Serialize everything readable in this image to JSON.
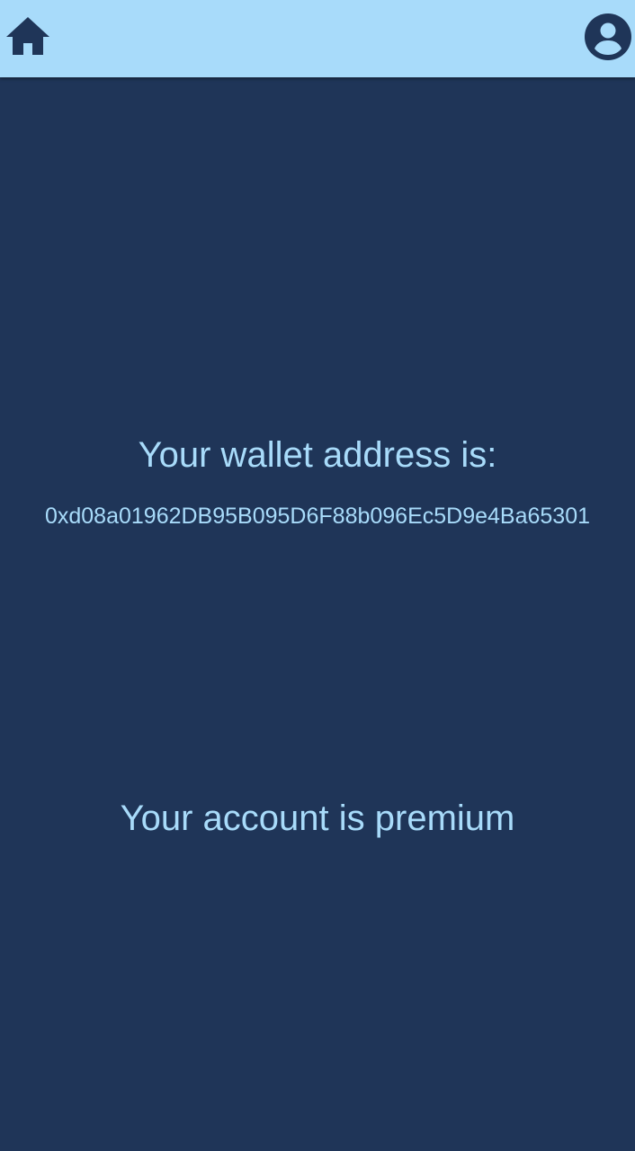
{
  "header": {
    "home_icon": "home-icon",
    "account_icon": "account-circle-icon"
  },
  "main": {
    "wallet_label": "Your wallet address is:",
    "wallet_address": "0xd08a01962DB95B095D6F88b096Ec5D9e4Ba65301",
    "account_status": "Your account is premium"
  },
  "colors": {
    "background": "#1f3558",
    "header": "#a8dbfa",
    "text": "#a8dbfa"
  }
}
